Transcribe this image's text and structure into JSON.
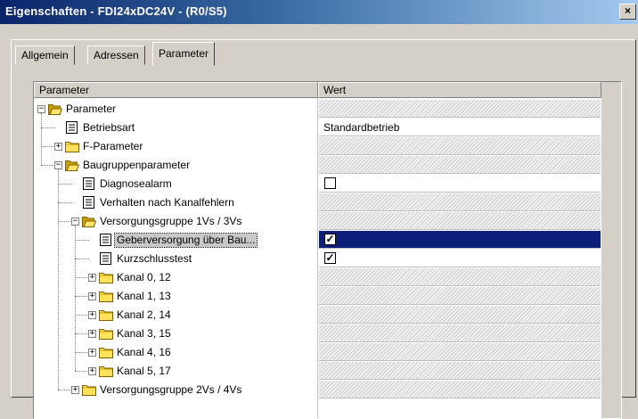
{
  "window": {
    "title": "Eigenschaften - FDI24xDC24V - (R0/S5)",
    "close_label": "×"
  },
  "tabs": [
    "Allgemein",
    "Adressen",
    "Parameter"
  ],
  "grid": {
    "col_param": "Parameter",
    "col_value": "Wert"
  },
  "rows": [
    {
      "label": "Parameter",
      "kind": "folder-open",
      "expander": "−",
      "value": "",
      "valueType": "hatch"
    },
    {
      "label": "Betriebsart",
      "kind": "doc",
      "value": "Standardbetrieb",
      "valueType": "text"
    },
    {
      "label": "F-Parameter",
      "kind": "folder",
      "expander": "+",
      "value": "",
      "valueType": "hatch"
    },
    {
      "label": "Baugruppenparameter",
      "kind": "folder-open",
      "expander": "−",
      "value": "",
      "valueType": "hatch"
    },
    {
      "label": "Diagnosealarm",
      "kind": "doc",
      "value": "",
      "valueType": "check",
      "checked": false
    },
    {
      "label": "Verhalten nach Kanalfehlern",
      "kind": "doc",
      "value": "",
      "valueType": "hatch"
    },
    {
      "label": "Versorgungsgruppe 1Vs / 3Vs",
      "kind": "folder-open",
      "expander": "−",
      "value": "",
      "valueType": "hatch"
    },
    {
      "label": "Geberversorgung über Bau...",
      "kind": "doc",
      "value": "",
      "valueType": "check",
      "checked": true,
      "selected": true
    },
    {
      "label": "Kurzschlusstest",
      "kind": "doc",
      "value": "",
      "valueType": "check",
      "checked": true
    },
    {
      "label": "Kanal 0, 12",
      "kind": "folder",
      "expander": "+",
      "value": "",
      "valueType": "hatch"
    },
    {
      "label": "Kanal 1, 13",
      "kind": "folder",
      "expander": "+",
      "value": "",
      "valueType": "hatch"
    },
    {
      "label": "Kanal 2, 14",
      "kind": "folder",
      "expander": "+",
      "value": "",
      "valueType": "hatch"
    },
    {
      "label": "Kanal 3, 15",
      "kind": "folder",
      "expander": "+",
      "value": "",
      "valueType": "hatch"
    },
    {
      "label": "Kanal 4, 16",
      "kind": "folder",
      "expander": "+",
      "value": "",
      "valueType": "hatch"
    },
    {
      "label": "Kanal 5, 17",
      "kind": "folder",
      "expander": "+",
      "value": "",
      "valueType": "hatch"
    },
    {
      "label": "Versorgungsgruppe 2Vs / 4Vs",
      "kind": "folder",
      "expander": "+",
      "value": "",
      "valueType": "hatch"
    }
  ]
}
